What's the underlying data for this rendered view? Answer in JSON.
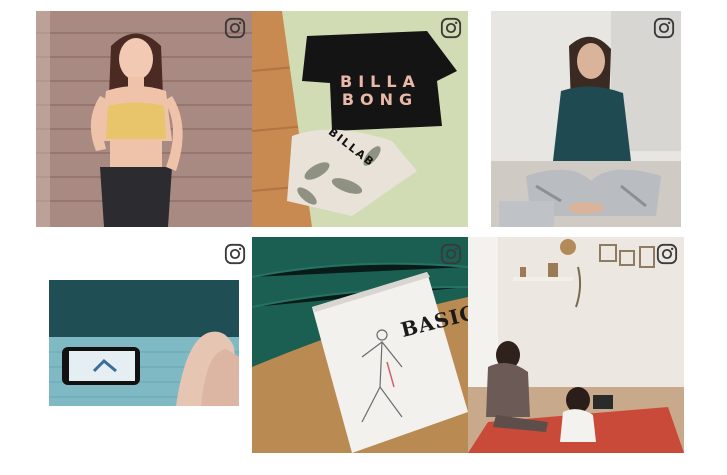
{
  "gallery": {
    "tiles": [
      {
        "id": "photo-1",
        "subject": "woman-yellow-top"
      },
      {
        "id": "photo-2",
        "subject": "billabong-flatlay",
        "shirt_text": "BILLA\nBONG",
        "leggings_text": "BILLAB"
      },
      {
        "id": "photo-3",
        "subject": "woman-meditating"
      },
      {
        "id": "photo-4",
        "subject": "phone-yoga-video"
      },
      {
        "id": "photo-5",
        "subject": "basic-book",
        "book_title": "BASIC"
      },
      {
        "id": "photo-6",
        "subject": "mother-daughter-room"
      }
    ],
    "icon": "instagram-icon"
  },
  "colors": {
    "background": "#ffffff",
    "icon_stroke": "#3a3a3a"
  }
}
